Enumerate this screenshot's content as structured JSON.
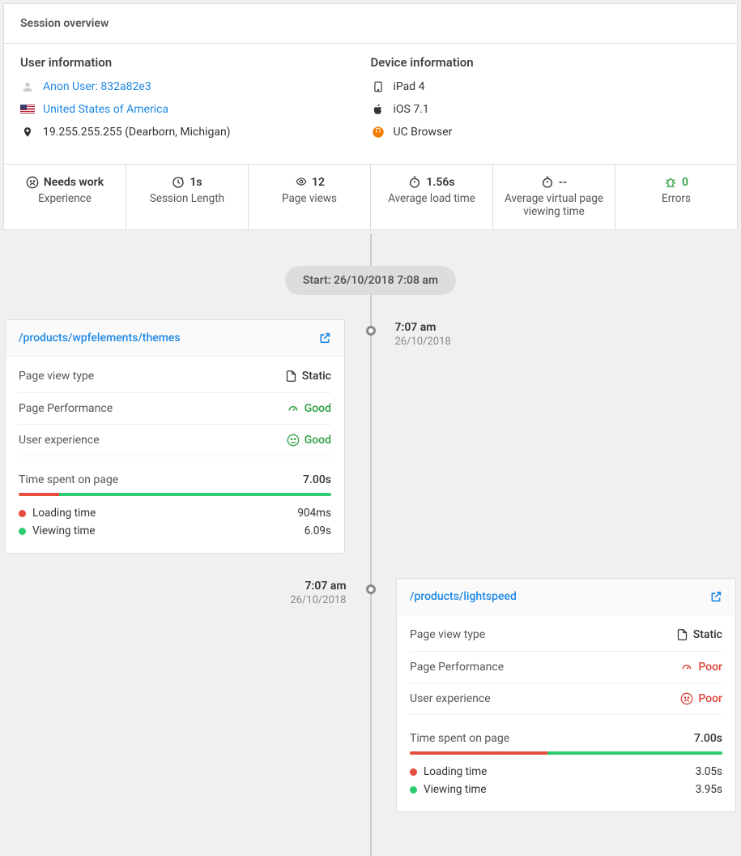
{
  "header": {
    "title": "Session overview"
  },
  "user_info": {
    "title": "User information",
    "name": "Anon User: 832a82e3",
    "country": "United States of America",
    "ip": "19.255.255.255 (Dearborn, Michigan)"
  },
  "device_info": {
    "title": "Device information",
    "device": "iPad 4",
    "os": "iOS 7.1",
    "browser": "UC Browser"
  },
  "stats": {
    "experience": {
      "value": "Needs work",
      "label": "Experience"
    },
    "session_length": {
      "value": "1s",
      "label": "Session Length"
    },
    "page_views": {
      "value": "12",
      "label": "Page views"
    },
    "avg_load": {
      "value": "1.56s",
      "label": "Average load time"
    },
    "avg_virtual": {
      "value": "--",
      "label": "Average virtual page viewing time"
    },
    "errors": {
      "value": "0",
      "label": "Errors"
    }
  },
  "timeline": {
    "start_label": "Start: 26/10/2018 7:08 am",
    "entries": [
      {
        "side": "left",
        "time": "7:07 am",
        "date": "26/10/2018",
        "url": "/products/wpfelements/themes",
        "page_view_type": "Static",
        "performance": "Good",
        "experience": "Good",
        "time_spent": "7.00s",
        "loading_time": "904ms",
        "viewing_time": "6.09s",
        "load_pct": 13
      },
      {
        "side": "right",
        "time": "7:07 am",
        "date": "26/10/2018",
        "url": "/products/lightspeed",
        "page_view_type": "Static",
        "performance": "Poor",
        "experience": "Poor",
        "time_spent": "7.00s",
        "loading_time": "3.05s",
        "viewing_time": "3.95s",
        "load_pct": 44
      }
    ]
  },
  "labels": {
    "page_view_type": "Page view type",
    "page_performance": "Page Performance",
    "user_experience": "User experience",
    "time_spent": "Time spent on page",
    "loading_time": "Loading time",
    "viewing_time": "Viewing time"
  }
}
